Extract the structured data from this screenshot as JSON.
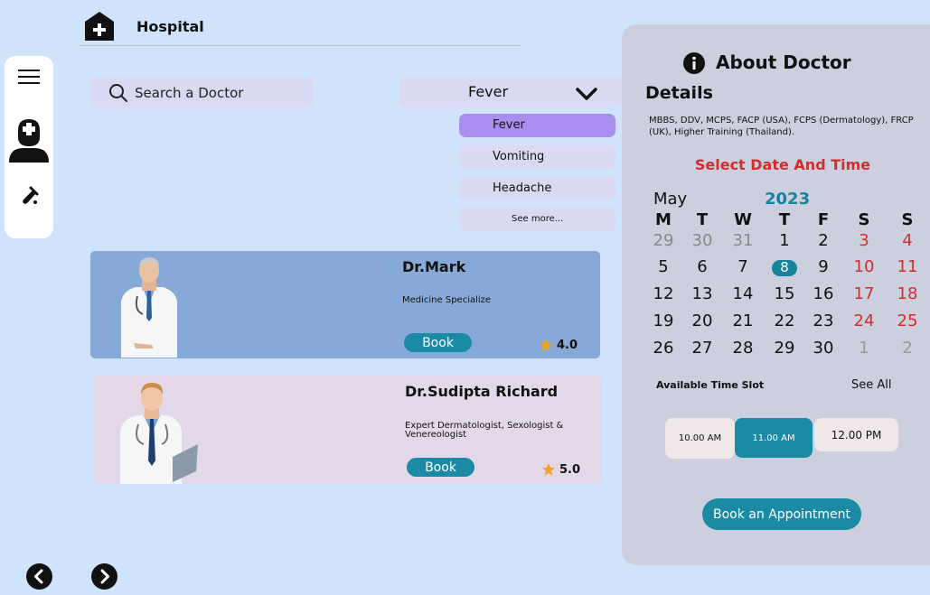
{
  "header": {
    "title": "Hospital",
    "logo_icon": "hospital-icon"
  },
  "rail": {
    "items": [
      {
        "icon": "menu-icon"
      },
      {
        "icon": "doctor-icon"
      },
      {
        "icon": "test-tube-icon"
      }
    ]
  },
  "search": {
    "placeholder": "Search a Doctor",
    "value": "",
    "icon": "search-icon"
  },
  "symptom_select": {
    "selected": "Fever",
    "options": [
      "Fever",
      "Vomiting",
      "Headache"
    ],
    "more_label": "See more..."
  },
  "doctors": [
    {
      "name": "Dr.Mark",
      "specialty": "Medicine Specialize",
      "book_label": "Book",
      "rating": "4.0"
    },
    {
      "name": "Dr.Sudipta Richard",
      "specialty": "Expert Dermatologist, Sexologist & Venereologist",
      "book_label": "Book",
      "rating": "5.0"
    }
  ],
  "about": {
    "title": "About Doctor",
    "details_title": "Details",
    "details_text": "MBBS, DDV, MCPS, FACP (USA), FCPS (Dermatology), FRCP (UK), Higher Training (Thailand).",
    "select_date_title": "Select Date And Time"
  },
  "calendar": {
    "month": "May",
    "year": "2023",
    "weekdays": [
      "M",
      "T",
      "W",
      "T",
      "F",
      "S",
      "S"
    ],
    "weeks": [
      [
        "29",
        "30",
        "31",
        "1",
        "2",
        "3",
        "4"
      ],
      [
        "5",
        "6",
        "7",
        "8",
        "9",
        "10",
        "11"
      ],
      [
        "12",
        "13",
        "14",
        "15",
        "16",
        "17",
        "18"
      ],
      [
        "19",
        "20",
        "21",
        "22",
        "23",
        "24",
        "25"
      ],
      [
        "26",
        "27",
        "28",
        "29",
        "30",
        "1",
        "2"
      ]
    ],
    "selected_day": "8"
  },
  "time_slots": {
    "label": "Available Time Slot",
    "see_all": "See All",
    "slots": [
      "10.00 AM",
      "11.00 AM",
      "12.00 PM"
    ],
    "selected": "11.00 AM"
  },
  "appointment_button": "Book an Appointment",
  "colors": {
    "accent": "#1b8aa4",
    "weekend": "#d12f2f",
    "page_bg": "#cfe3fb"
  }
}
